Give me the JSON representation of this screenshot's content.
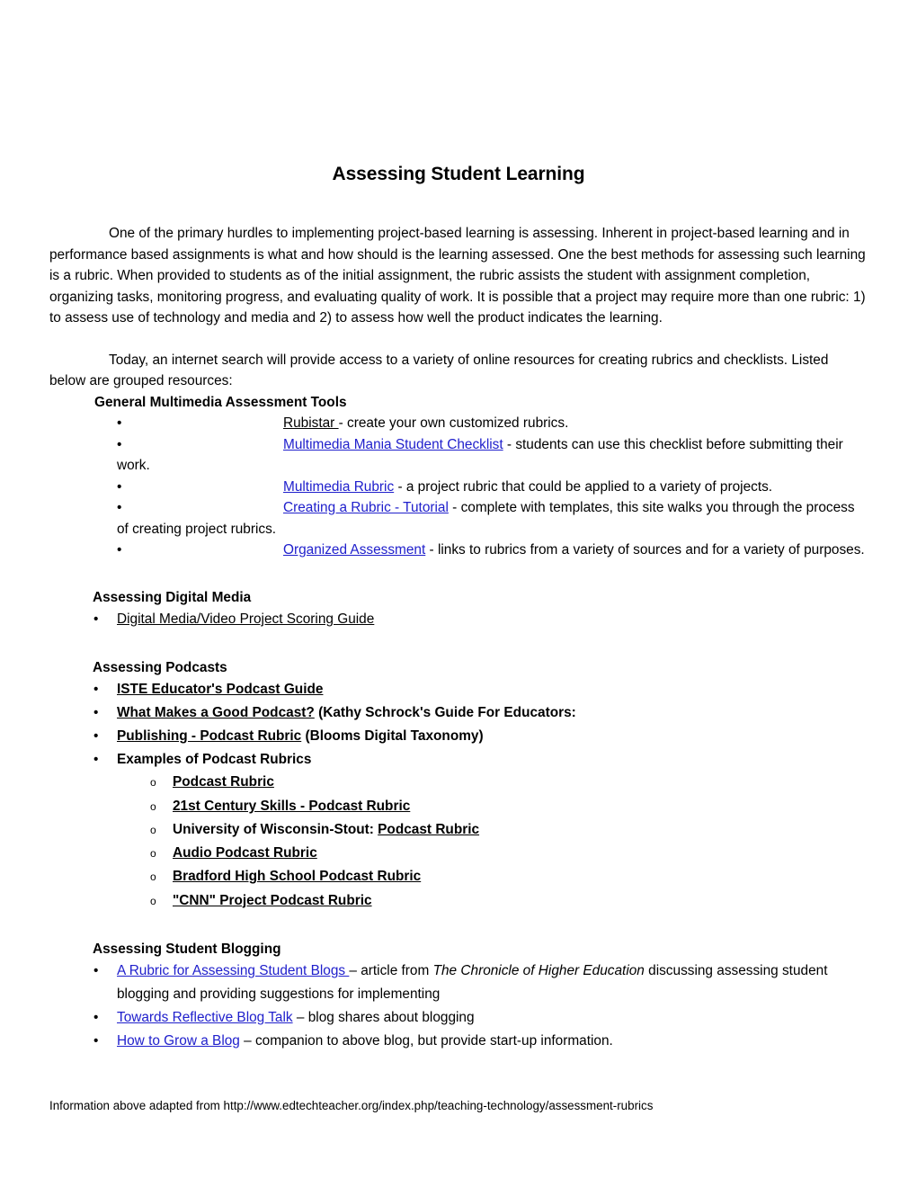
{
  "document": {
    "title": "Assessing Student Learning",
    "paragraphs": [
      "One of the primary hurdles to implementing project-based learning is assessing.  Inherent in project-based learning and in performance based assignments is what and how should is the learning assessed.   One the best methods for assessing such learning is a rubric.  When provided to students as of the initial assignment, the rubric assists the student with assignment completion, organizing tasks, monitoring progress, and evaluating quality of work.  It is possible that a project may require more than one rubric: 1) to assess use of technology and media and 2) to assess how well the product indicates the learning.",
      "Today, an internet search will provide access to a variety of online resources for creating rubrics and checklists.  Listed below are grouped resources:"
    ],
    "sections": {
      "general_multimedia": {
        "heading": "General Multimedia Assessment Tools",
        "items": [
          {
            "link": "Rubistar ",
            "rest": "- create your own customized rubrics."
          },
          {
            "link": "Multimedia Mania Student Checklist",
            "rest": " - students can use this checklist before submitting their work."
          },
          {
            "link": "Multimedia Rubric",
            "rest": " - a project rubric that could be applied to a variety of projects."
          },
          {
            "link": "Creating a Rubric - Tutorial",
            "rest": " - complete with templates, this site walks you through the process of creating project rubrics."
          },
          {
            "link": "Organized Assessment",
            "rest": " - links to rubrics from a variety of sources and for a variety of purposes."
          }
        ]
      },
      "digital_media": {
        "heading": "Assessing Digital Media",
        "items": [
          {
            "link": "Digital Media/Video Project Scoring Guide",
            "rest": ""
          }
        ]
      },
      "podcasts": {
        "heading": "Assessing Podcasts",
        "items": [
          {
            "link": "ISTE Educator's Podcast Guide",
            "rest": ""
          },
          {
            "link": "What Makes a Good Podcast?",
            "rest": " (Kathy Schrock's Guide For Educators:"
          },
          {
            "link": "Publishing - Podcast Rubric",
            "rest": " (Blooms Digital Taxonomy)"
          },
          {
            "link": "",
            "rest": "Examples of Podcast Rubrics"
          }
        ],
        "examples_label": "Examples of Podcast Rubrics",
        "examples": [
          {
            "pre": "",
            "link": "Podcast Rubric"
          },
          {
            "pre": "",
            "link": "21st Century Skills - Podcast Rubric"
          },
          {
            "pre": "University of Wisconsin-Stout: ",
            "link": "Podcast Rubric"
          },
          {
            "pre": "",
            "link": "Audio Podcast Rubric"
          },
          {
            "pre": "",
            "link": "Bradford High School Podcast Rubric"
          },
          {
            "pre": "",
            "link": "\"CNN\" Project Podcast Rubric"
          }
        ]
      },
      "blogging": {
        "heading": "Assessing Student Blogging",
        "items": [
          {
            "link": "A Rubric for Assessing Student Blogs ",
            "mid": "– article from ",
            "italic": "The Chronicle of Higher Education",
            "tail": " discussing assessing student blogging and providing suggestions for implementing"
          },
          {
            "link": "Towards Reflective Blog Talk",
            "mid": " – blog shares about blogging",
            "italic": "",
            "tail": ""
          },
          {
            "link": "How to Grow a Blog",
            "mid": " – companion to above blog, but provide start-up information.",
            "italic": "",
            "tail": ""
          }
        ]
      }
    },
    "footer": "Information above adapted from http://www.edtechteacher.org/index.php/teaching-technology/assessment-rubrics",
    "bullet_glyph": "•",
    "sub_bullet_glyph": "o",
    "colors": {
      "link_blue": "#2020CC",
      "text_black": "#000000"
    }
  }
}
